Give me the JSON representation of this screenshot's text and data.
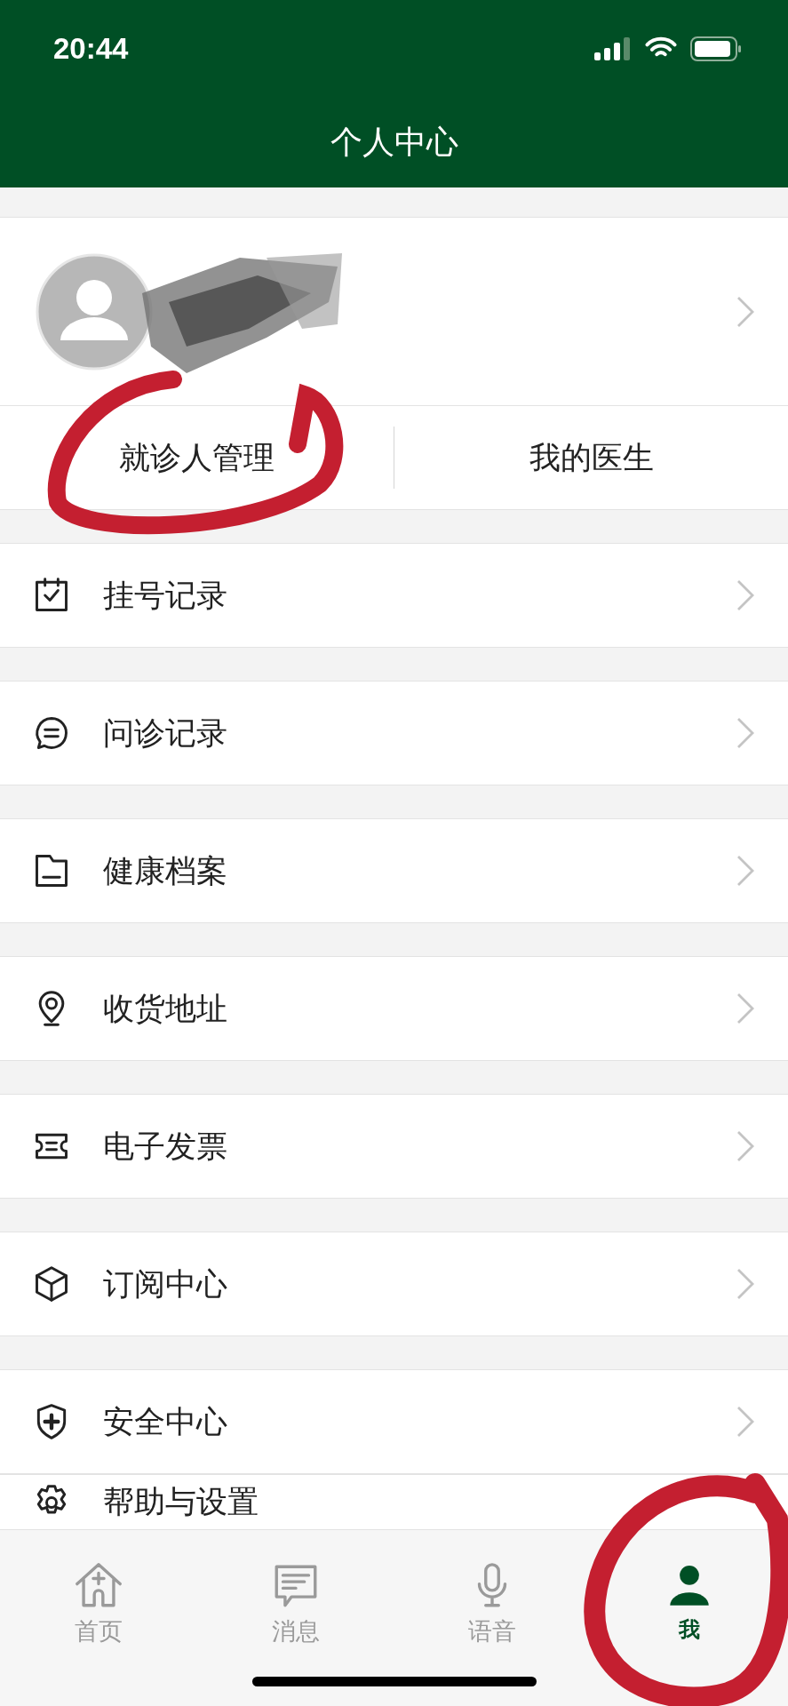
{
  "status_bar": {
    "time": "20:44"
  },
  "header": {
    "title": "个人中心"
  },
  "profile_tabs": [
    {
      "label": "就诊人管理"
    },
    {
      "label": "我的医生"
    }
  ],
  "menu": [
    {
      "kind": "calendar",
      "label": "挂号记录"
    },
    {
      "kind": "chat",
      "label": "问诊记录"
    },
    {
      "kind": "folder",
      "label": "健康档案"
    },
    {
      "kind": "location",
      "label": "收货地址"
    },
    {
      "kind": "ticket",
      "label": "电子发票"
    },
    {
      "kind": "box",
      "label": "订阅中心"
    },
    {
      "kind": "shield",
      "label": "安全中心"
    },
    {
      "kind": "gear",
      "label": "帮助与设置"
    }
  ],
  "tab_bar": [
    {
      "kind": "home",
      "label": "首页",
      "selected": false
    },
    {
      "kind": "message",
      "label": "消息",
      "selected": false
    },
    {
      "kind": "voice",
      "label": "语音",
      "selected": false
    },
    {
      "kind": "me",
      "label": "我",
      "selected": true
    }
  ]
}
